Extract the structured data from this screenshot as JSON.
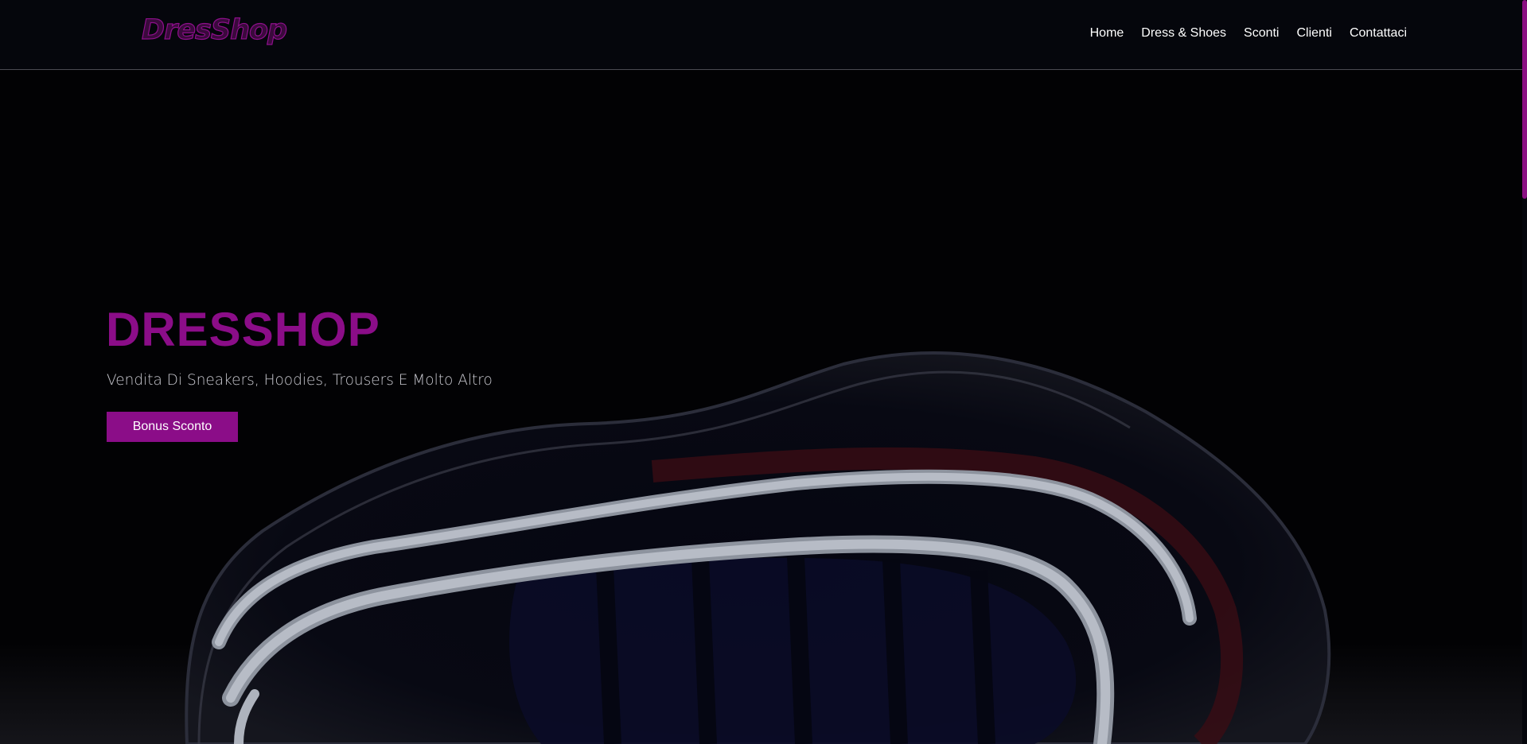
{
  "brand": {
    "logo_text": "DresShop"
  },
  "nav": {
    "items": [
      "Home",
      "Dress & Shoes",
      "Sconti",
      "Clienti",
      "Contattaci"
    ]
  },
  "hero": {
    "title": "DRESSHOP",
    "subtitle": "Vendita Di Sneakers, Hoodies, Trousers E Molto Altro",
    "button_label": "Bonus Sconto"
  },
  "colors": {
    "accent": "#8b0d88",
    "background": "#020204",
    "navbar": "#05060c"
  }
}
